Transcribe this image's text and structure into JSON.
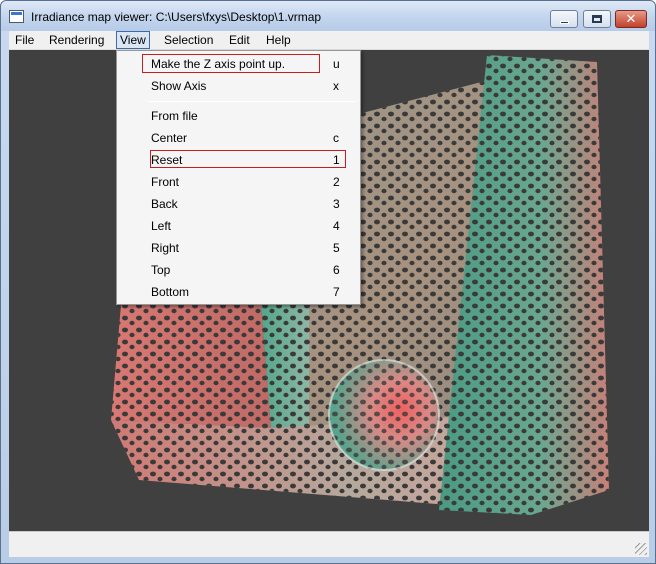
{
  "window": {
    "title": "Irradiance map viewer: C:\\Users\\fxys\\Desktop\\1.vrmap",
    "controls": {
      "minimize_icon": "minimize-icon",
      "maximize_icon": "maximize-icon",
      "close_glyph": "✕"
    }
  },
  "menubar": {
    "items": [
      {
        "label": "File"
      },
      {
        "label": "Rendering"
      },
      {
        "label": "View"
      },
      {
        "label": "Selection"
      },
      {
        "label": "Edit"
      },
      {
        "label": "Help"
      }
    ],
    "active": "View"
  },
  "view_menu": {
    "items": [
      {
        "label": "Make the Z axis point up.",
        "shortcut": "u",
        "highlighted": true
      },
      {
        "label": "Show Axis",
        "shortcut": "x"
      },
      {
        "label": "From file",
        "shortcut": ""
      },
      {
        "label": "Center",
        "shortcut": "c"
      },
      {
        "label": "Reset",
        "shortcut": "1",
        "highlighted": true
      },
      {
        "label": "Front",
        "shortcut": "2"
      },
      {
        "label": "Back",
        "shortcut": "3"
      },
      {
        "label": "Left",
        "shortcut": "4"
      },
      {
        "label": "Right",
        "shortcut": "5"
      },
      {
        "label": "Top",
        "shortcut": "6"
      },
      {
        "label": "Bottom",
        "shortcut": "7"
      }
    ]
  },
  "viewport": {
    "background": "#404040",
    "colors": {
      "red": "#e07a72",
      "green": "#5fb59a",
      "gray": "#a89f90"
    }
  },
  "statusbar": {
    "text": ""
  }
}
